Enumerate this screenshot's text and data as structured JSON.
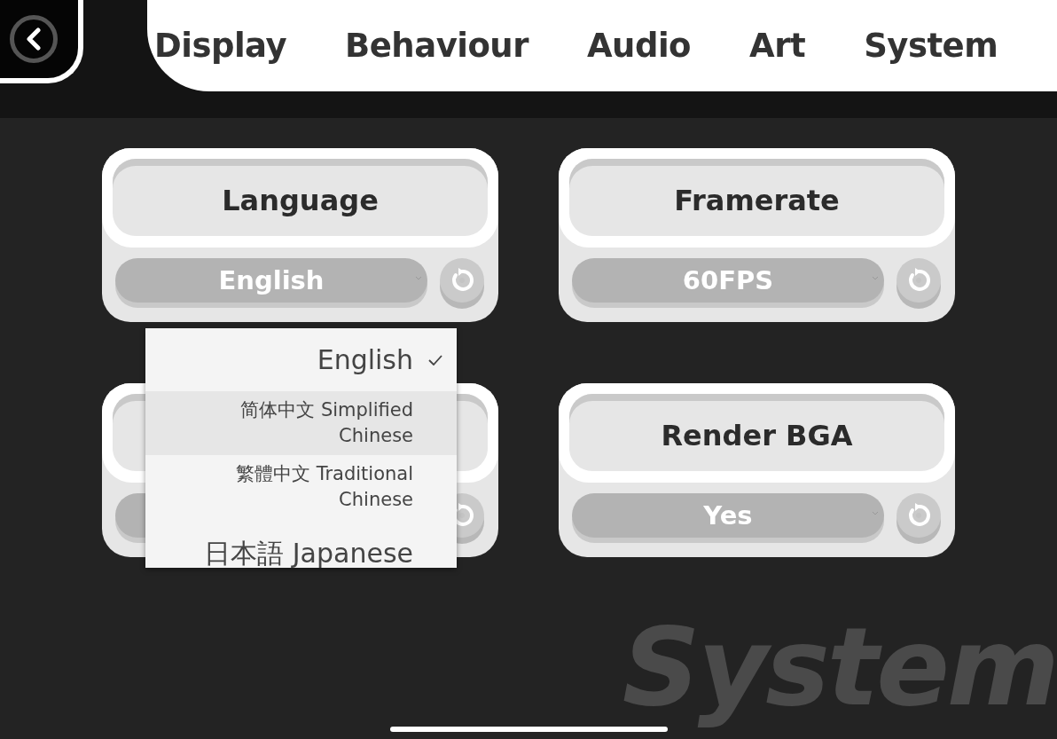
{
  "tabs": [
    {
      "label": "Display"
    },
    {
      "label": "Behaviour"
    },
    {
      "label": "Audio"
    },
    {
      "label": "Art"
    },
    {
      "label": "System"
    }
  ],
  "settings": [
    {
      "title": "Language",
      "value": "English"
    },
    {
      "title": "Framerate",
      "value": "60FPS"
    },
    {
      "title": "Render BGA",
      "value": "Yes"
    }
  ],
  "language_menu": {
    "options": [
      {
        "label": "English",
        "selected": true,
        "highlighted": false
      },
      {
        "label": "简体中文 Simplified Chinese",
        "selected": false,
        "highlighted": true
      },
      {
        "label": "繁體中文 Traditional Chinese",
        "selected": false,
        "highlighted": false
      },
      {
        "label": "日本語 Japanese",
        "selected": false,
        "highlighted": false
      }
    ]
  },
  "section_watermark": "System"
}
